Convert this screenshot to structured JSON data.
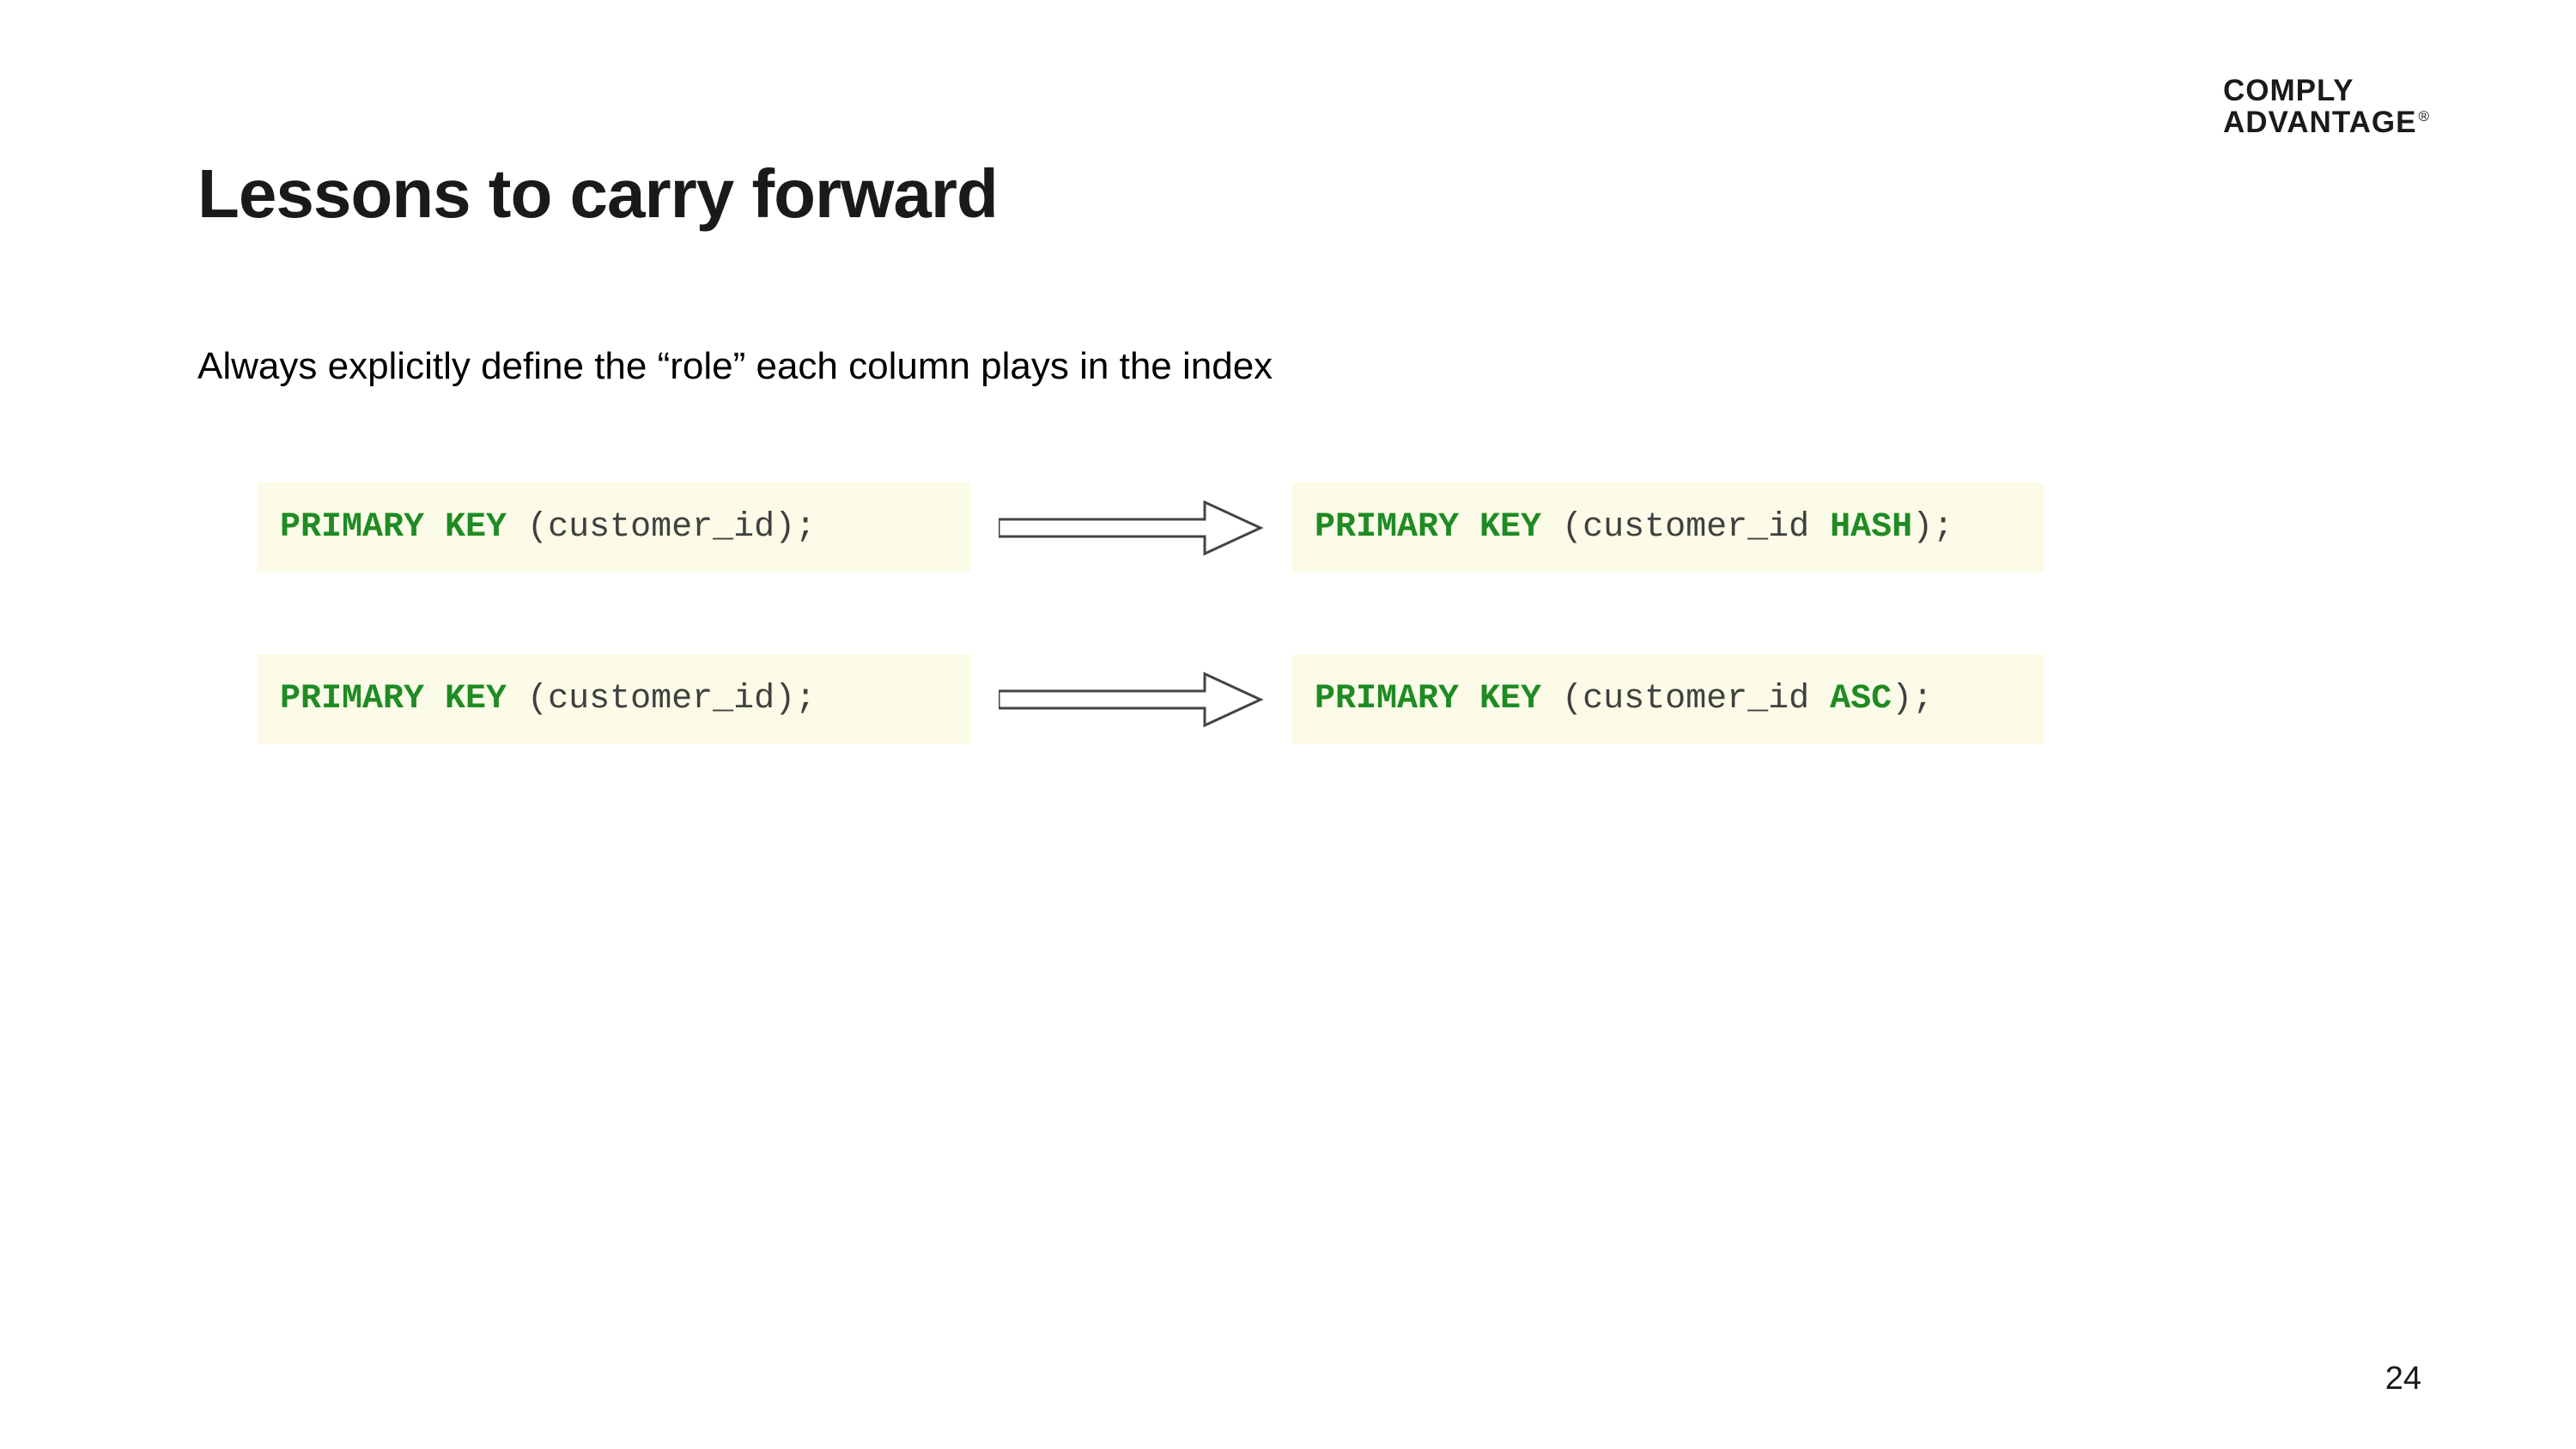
{
  "logo": {
    "line1": "COMPLY",
    "line2": "ADVANTAGE",
    "reg": "®"
  },
  "title": "Lessons to carry forward",
  "subtitle": "Always explicitly define the “role” each column plays in the index",
  "rows": [
    {
      "left": {
        "kw1": "PRIMARY KEY",
        "paren_open": " (",
        "col": "customer_id",
        "paren_close": ");"
      },
      "right": {
        "kw1": "PRIMARY KEY",
        "paren_open": " (",
        "col": "customer_id ",
        "kw2": "HASH",
        "paren_close": ");"
      }
    },
    {
      "left": {
        "kw1": "PRIMARY KEY",
        "paren_open": " (",
        "col": "customer_id",
        "paren_close": ");"
      },
      "right": {
        "kw1": "PRIMARY KEY",
        "paren_open": " (",
        "col": "customer_id ",
        "kw2": "ASC",
        "paren_close": ");"
      }
    }
  ],
  "page_number": "24"
}
